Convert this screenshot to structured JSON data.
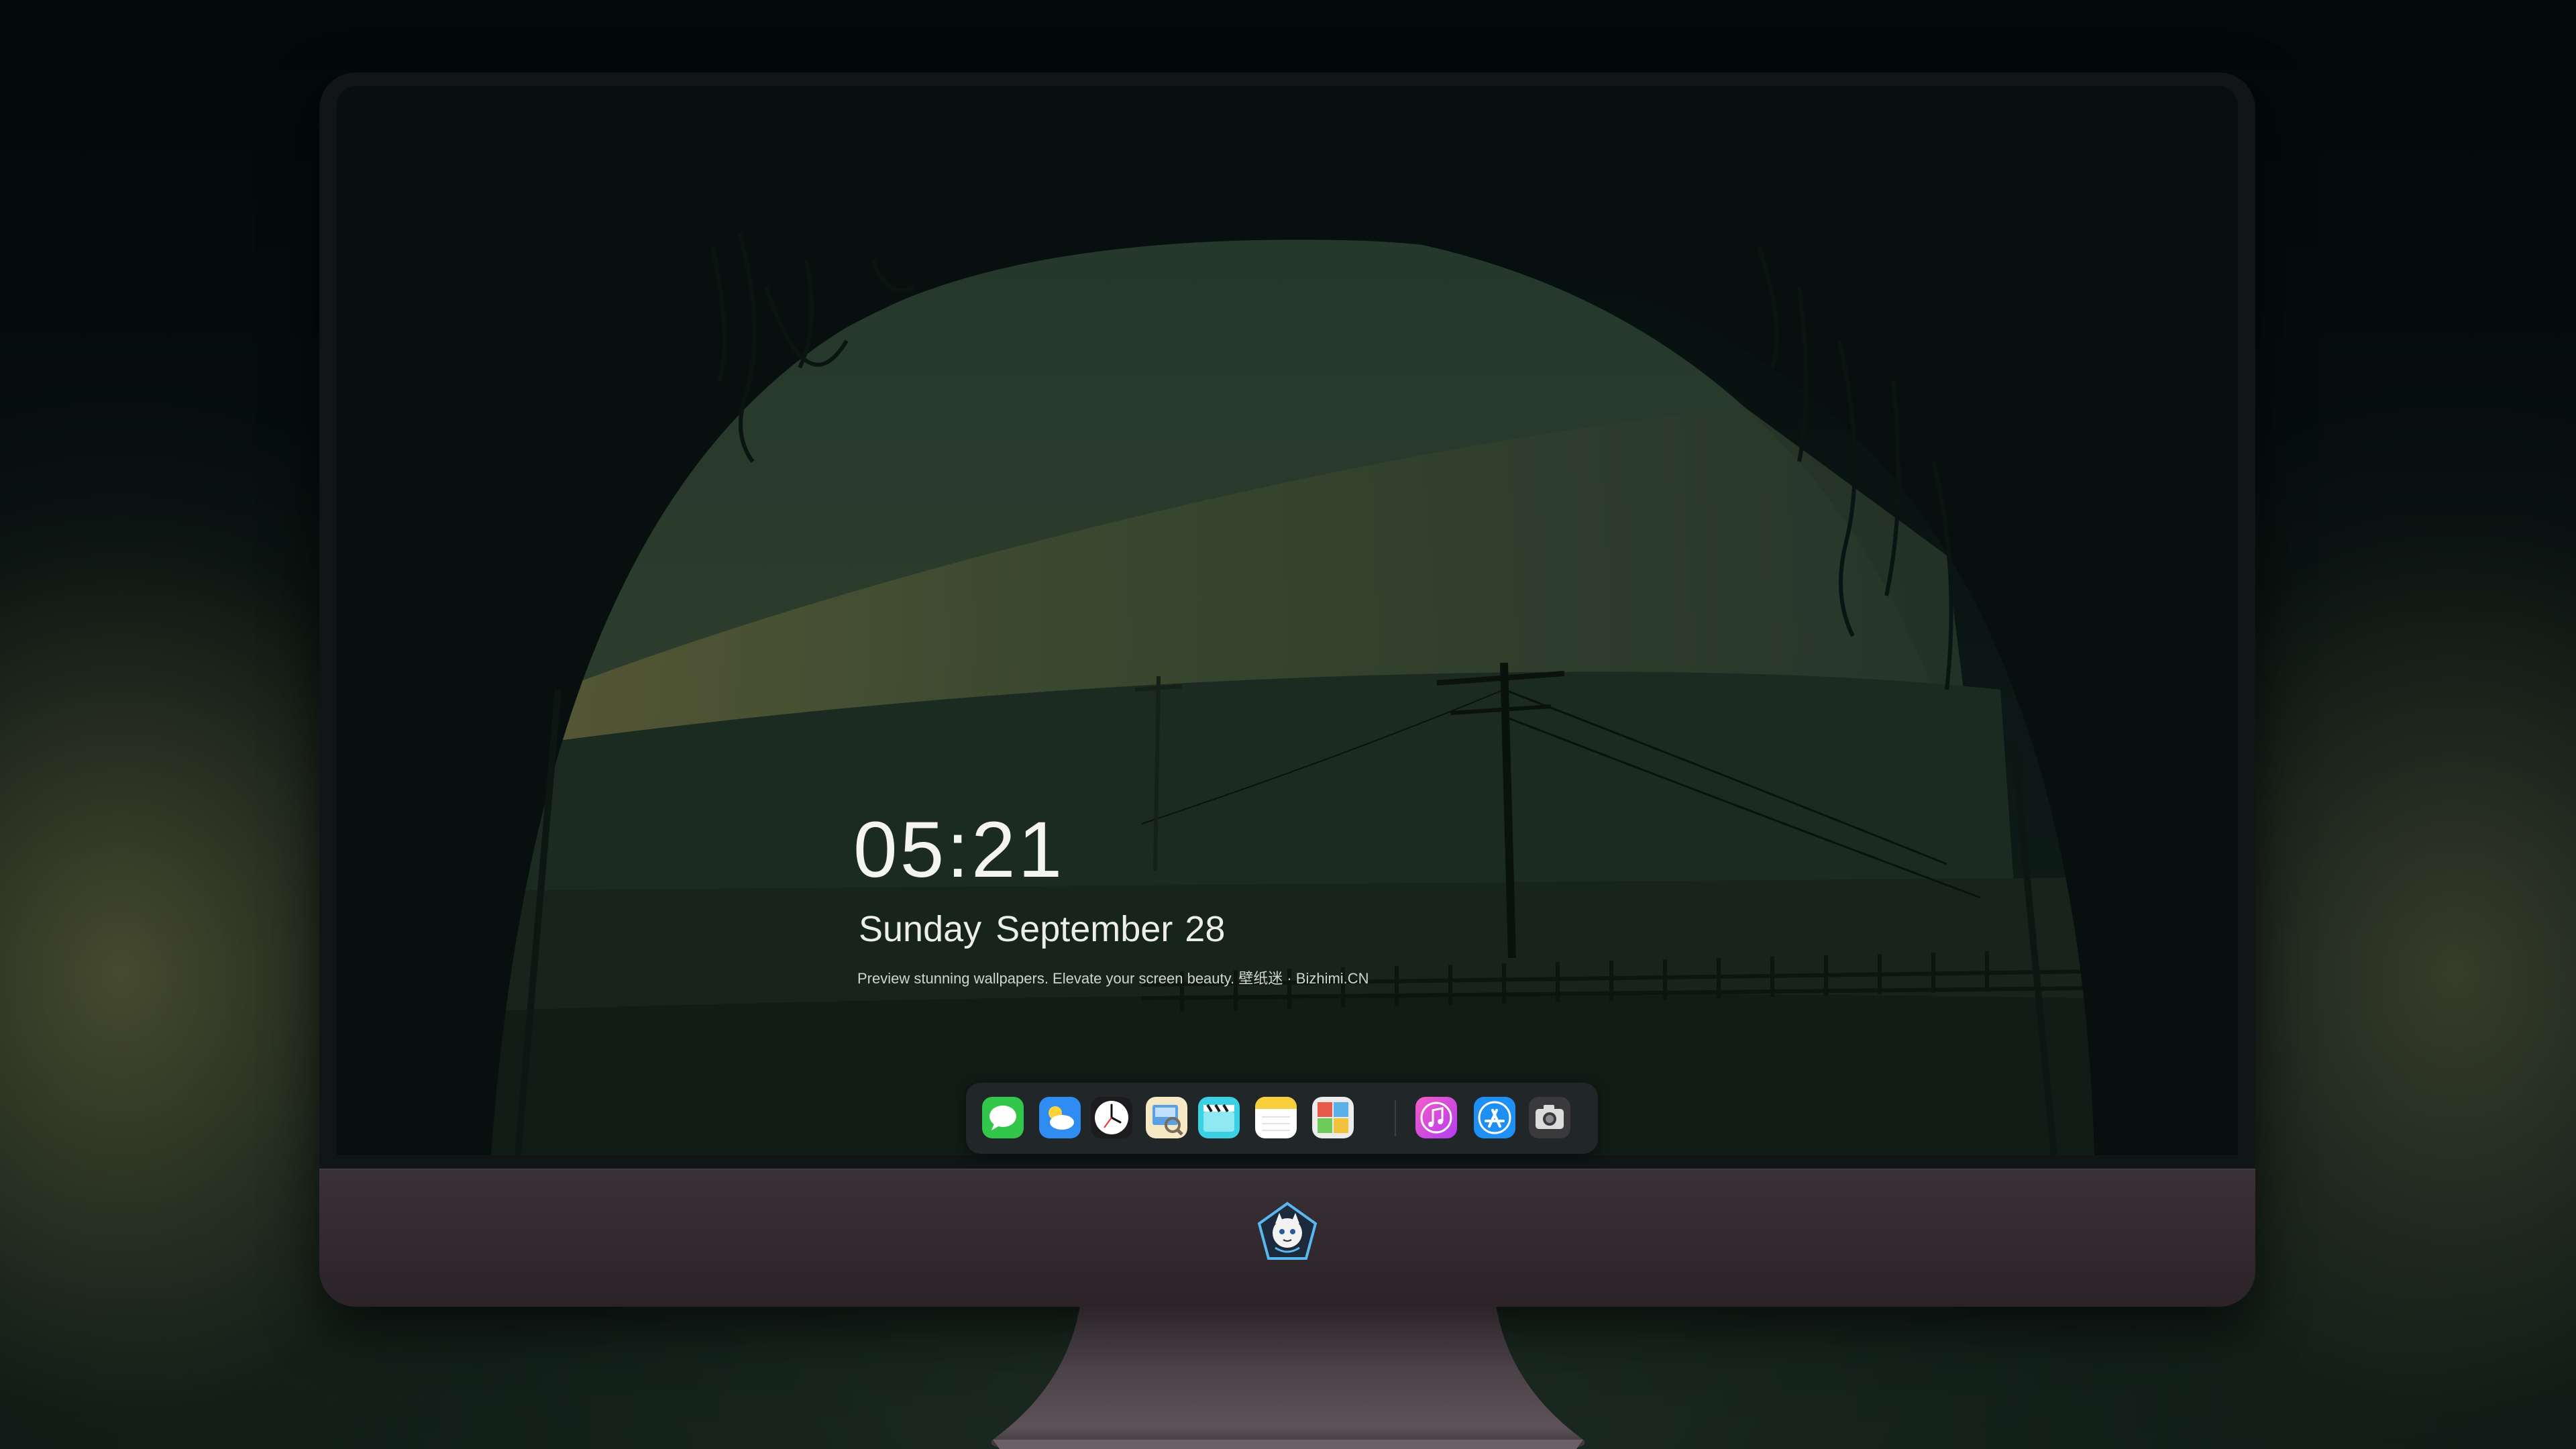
{
  "lock_screen": {
    "time": "05:21",
    "weekday_month": "Sunday September",
    "day": "28",
    "tagline": "Preview stunning wallpapers. Elevate your screen beauty. 壁纸迷 · Bizhimi.CN"
  },
  "dock": {
    "items": [
      {
        "icon": "messages-icon"
      },
      {
        "icon": "weather-icon"
      },
      {
        "icon": "clock-icon"
      },
      {
        "icon": "preview-icon"
      },
      {
        "icon": "clips-icon"
      },
      {
        "icon": "notes-icon"
      },
      {
        "icon": "photo-booth-icon"
      },
      {
        "icon": "music-icon"
      },
      {
        "icon": "app-store-icon"
      },
      {
        "icon": "camera-icon"
      }
    ]
  },
  "monitor": {
    "logo_icon": "mascot-logo-icon"
  }
}
